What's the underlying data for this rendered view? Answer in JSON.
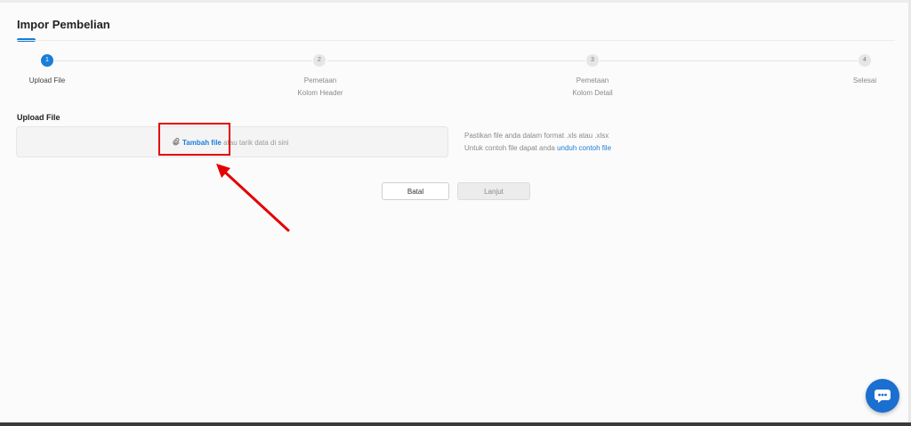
{
  "page": {
    "title": "Impor Pembelian"
  },
  "stepper": {
    "steps": [
      {
        "number": "1",
        "label": "Upload File",
        "active": true
      },
      {
        "number": "2",
        "label": "Pemetaan Kolom Header",
        "active": false
      },
      {
        "number": "3",
        "label": "Pemetaan Kolom Detail",
        "active": false
      },
      {
        "number": "4",
        "label": "Selesai",
        "active": false
      }
    ]
  },
  "upload": {
    "label": "Upload File",
    "add_file_link": "Tambah file",
    "drag_text": "atau tarik data di sini",
    "hint_format": "Pastikan file anda dalam format .xls atau .xlsx",
    "hint_example_prefix": "Untuk contoh file dapat anda ",
    "hint_example_link": "unduh contoh file"
  },
  "actions": {
    "cancel_label": "Batal",
    "next_label": "Lanjut"
  },
  "colors": {
    "accent": "#1a7ed8",
    "annotation": "#e40000"
  },
  "icons": {
    "attach": "paperclip-icon",
    "chat": "chat-bubble-icon"
  }
}
